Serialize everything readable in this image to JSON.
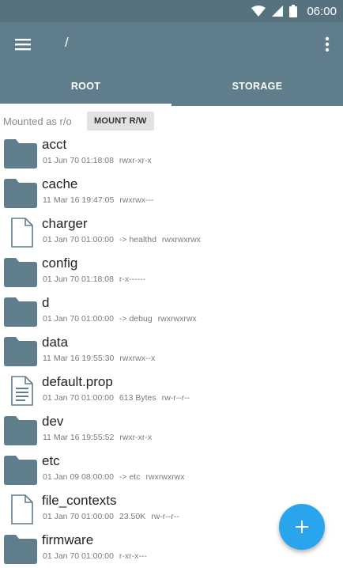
{
  "status_bar": {
    "time": "06:00",
    "icons": [
      "wifi-icon",
      "signal-icon",
      "battery-icon"
    ]
  },
  "toolbar": {
    "path": "/",
    "menu_icon": "hamburger-menu-icon",
    "overflow_icon": "overflow-menu-icon"
  },
  "tabs": [
    {
      "label": "ROOT",
      "selected": true
    },
    {
      "label": "STORAGE",
      "selected": false
    }
  ],
  "mount": {
    "status": "Mounted as r/o",
    "button_label": "MOUNT R/W"
  },
  "files": [
    {
      "name": "acct",
      "type": "folder",
      "date": "01 Jun 70 01:18:08",
      "info": "",
      "perms": "rwxr-xr-x"
    },
    {
      "name": "cache",
      "type": "folder",
      "date": "11 Mar 16 19:47:05",
      "info": "",
      "perms": "rwxrwx---"
    },
    {
      "name": "charger",
      "type": "file",
      "date": "01 Jan 70 01:00:00",
      "info": "-> healthd",
      "perms": "rwxrwxrwx"
    },
    {
      "name": "config",
      "type": "folder",
      "date": "01 Jun 70 01:18:08",
      "info": "",
      "perms": "r-x------"
    },
    {
      "name": "d",
      "type": "folder",
      "date": "01 Jan 70 01:00:00",
      "info": "-> debug",
      "perms": "rwxrwxrwx"
    },
    {
      "name": "data",
      "type": "folder",
      "date": "11 Mar 16 19:55:30",
      "info": "",
      "perms": "rwxrwx--x"
    },
    {
      "name": "default.prop",
      "type": "document",
      "date": "01 Jan 70 01:00:00",
      "info": "613 Bytes",
      "perms": "rw-r--r--"
    },
    {
      "name": "dev",
      "type": "folder",
      "date": "11 Mar 16 19:55:52",
      "info": "",
      "perms": "rwxr-xr-x"
    },
    {
      "name": "etc",
      "type": "folder",
      "date": "01 Jan 09 08:00:00",
      "info": "-> etc",
      "perms": "rwxrwxrwx"
    },
    {
      "name": "file_contexts",
      "type": "file",
      "date": "01 Jan 70 01:00:00",
      "info": "23.50K",
      "perms": "rw-r--r--"
    },
    {
      "name": "firmware",
      "type": "folder",
      "date": "01 Jan 70 01:00:00",
      "info": "",
      "perms": "r-xr-x---"
    }
  ],
  "fab": {
    "icon": "plus-icon"
  },
  "colors": {
    "toolbar": "#5f7d8b",
    "status_bar": "#56727f",
    "folder_icon": "#5f7d8b",
    "fab": "#2aa5ed"
  }
}
